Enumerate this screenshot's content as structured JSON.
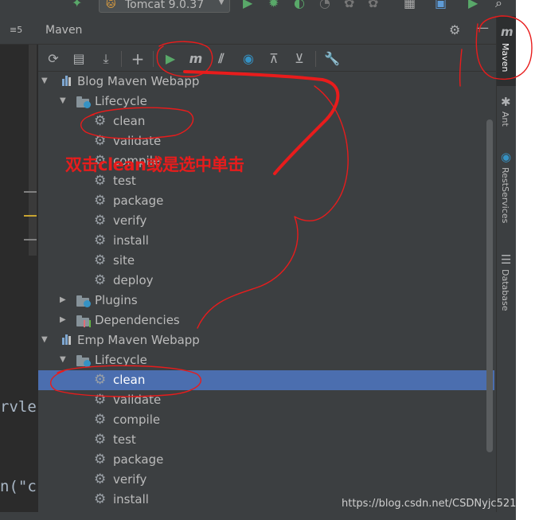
{
  "topbar": {
    "run_config": "Tomcat 9.0.37"
  },
  "editor": {
    "tab_fragment": "≡5",
    "code_line_1": "rvle",
    "code_line_2": "n(\"c"
  },
  "panel": {
    "title": "Maven"
  },
  "toolbar": {
    "icons": [
      "reload-icon",
      "generate-sources-icon",
      "download-icon",
      "add-icon",
      "run-icon",
      "execute-goal-icon",
      "toggle-offline-icon",
      "skip-tests-icon",
      "show-dependencies-icon",
      "collapse-all-icon",
      "settings-icon"
    ]
  },
  "tree": {
    "projects": [
      {
        "name": "Blog Maven Webapp",
        "lifecycle_label": "Lifecycle",
        "goals": [
          "clean",
          "validate",
          "compile",
          "test",
          "package",
          "verify",
          "install",
          "site",
          "deploy"
        ],
        "plugins_label": "Plugins",
        "dependencies_label": "Dependencies"
      },
      {
        "name": "Emp Maven Webapp",
        "lifecycle_label": "Lifecycle",
        "goals": [
          "clean",
          "validate",
          "compile",
          "test",
          "package",
          "verify",
          "install"
        ],
        "selected_goal": "clean"
      }
    ]
  },
  "right_tabs": [
    {
      "label": "Maven",
      "icon": "maven-icon",
      "active": true
    },
    {
      "label": "Ant",
      "icon": "ant-icon"
    },
    {
      "label": "RestServices",
      "icon": "rest-services-icon"
    },
    {
      "label": "Database",
      "icon": "database-icon"
    }
  ],
  "annotation": {
    "text": "双击clean或是选中单击",
    "color": "#e81c1c"
  },
  "watermark": "https://blog.csdn.net/CSDNyjc521",
  "colors": {
    "panel_bg": "#3c3f41",
    "selection": "#4b6eaf",
    "run_green": "#59a869",
    "annotation_red": "#e81c1c"
  }
}
